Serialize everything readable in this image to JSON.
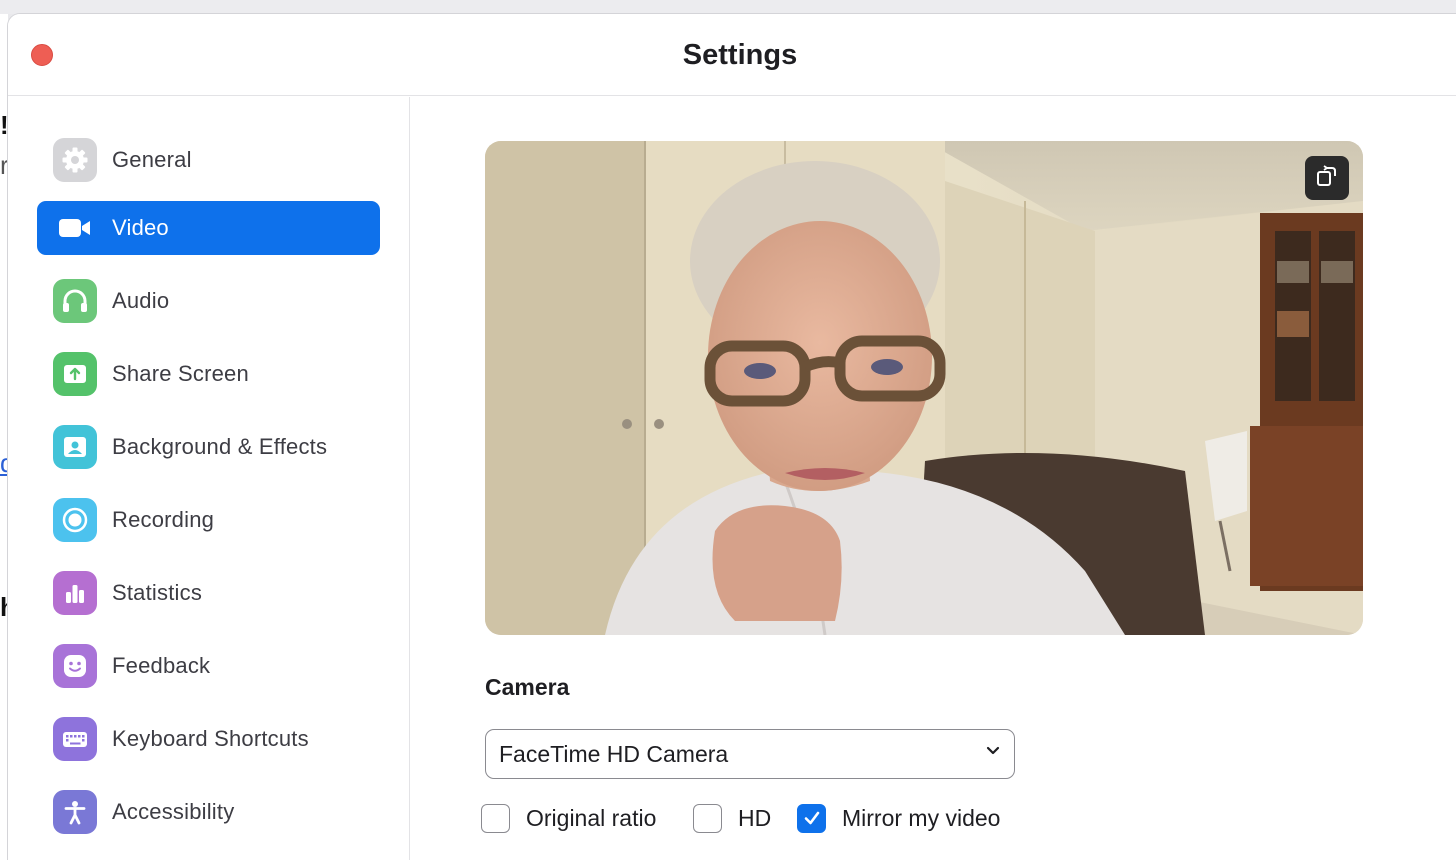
{
  "window": {
    "title": "Settings"
  },
  "background_fragments": {
    "g1": "!",
    "g2": "r",
    "link": "d",
    "g3": "h"
  },
  "sidebar": {
    "items": [
      {
        "label": "General",
        "icon": "gear-icon",
        "color": "#d3d3d6",
        "active": false
      },
      {
        "label": "Video",
        "icon": "video-camera-icon",
        "color": "#0e71eb",
        "active": true
      },
      {
        "label": "Audio",
        "icon": "headphones-icon",
        "color": "#6cc77a",
        "active": false
      },
      {
        "label": "Share Screen",
        "icon": "share-screen-icon",
        "color": "#54c26a",
        "active": false
      },
      {
        "label": "Background & Effects",
        "icon": "person-portrait-icon",
        "color": "#42c3d8",
        "active": false
      },
      {
        "label": "Recording",
        "icon": "record-icon",
        "color": "#4cc2ee",
        "active": false
      },
      {
        "label": "Statistics",
        "icon": "bar-chart-icon",
        "color": "#b56fd1",
        "active": false
      },
      {
        "label": "Feedback",
        "icon": "smiley-icon",
        "color": "#a873d8",
        "active": false
      },
      {
        "label": "Keyboard Shortcuts",
        "icon": "keyboard-icon",
        "color": "#8e73dc",
        "active": false
      },
      {
        "label": "Accessibility",
        "icon": "accessibility-icon",
        "color": "#7a78d6",
        "active": false
      }
    ]
  },
  "video": {
    "preview_icon": "rotate-camera-icon",
    "camera_section": "Camera",
    "camera_select": {
      "value": "FaceTime HD Camera"
    },
    "options": [
      {
        "label": "Original ratio",
        "checked": false
      },
      {
        "label": "HD",
        "checked": false
      },
      {
        "label": "Mirror my video",
        "checked": true
      }
    ]
  },
  "colors": {
    "accent": "#0e71eb",
    "close": "#ee5e54"
  }
}
